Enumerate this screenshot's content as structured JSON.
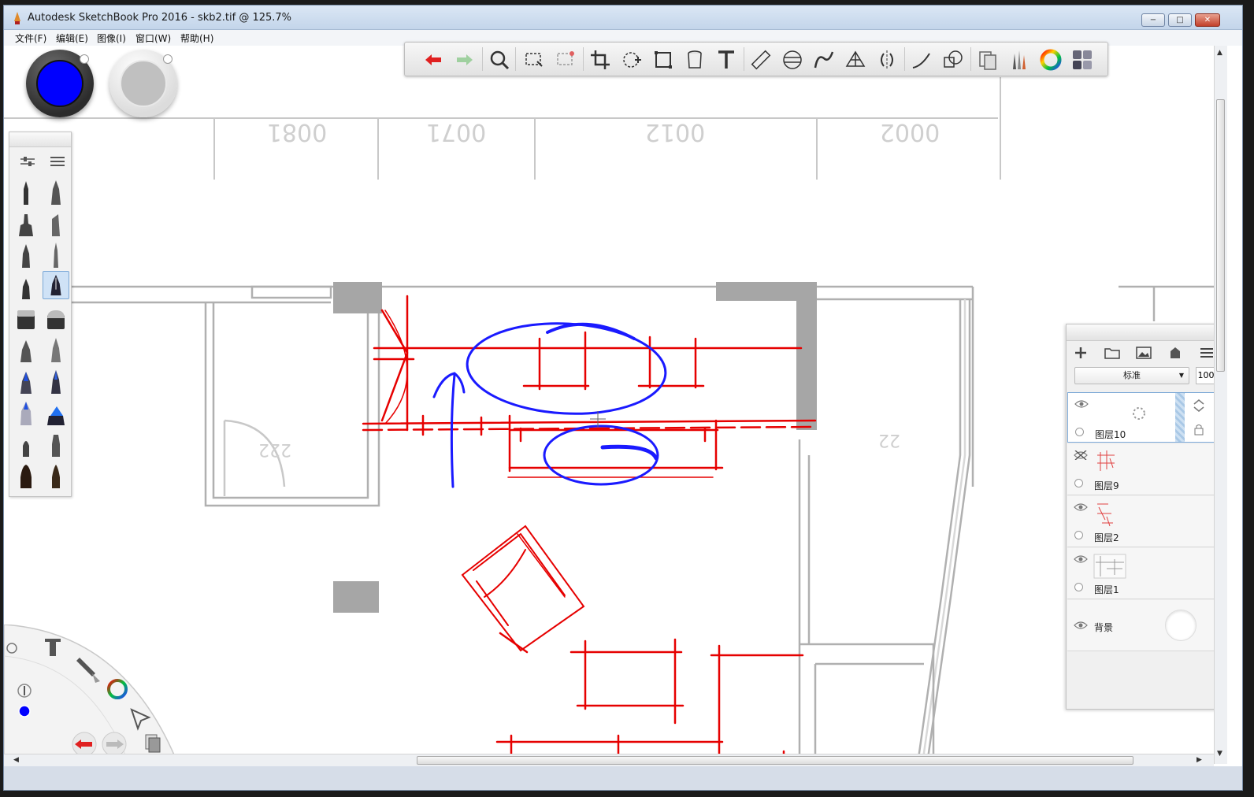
{
  "window": {
    "title": "Autodesk SketchBook Pro 2016 - skb2.tif @ 125.7%",
    "controls": {
      "minimize": "−",
      "maximize": "□",
      "close": "✕"
    }
  },
  "menu": [
    {
      "label": "文件(F)"
    },
    {
      "label": "编辑(E)"
    },
    {
      "label": "图像(I)"
    },
    {
      "label": "窗口(W)"
    },
    {
      "label": "帮助(H)"
    }
  ],
  "toolbar": {
    "tools": [
      "undo-icon",
      "redo-icon",
      "zoom-icon",
      "rect-select-icon",
      "lasso-select-icon",
      "crop-icon",
      "move-rotate-icon",
      "distort-icon",
      "fill-bucket-icon",
      "text-icon",
      "ruler-icon",
      "ellipse-guide-icon",
      "french-curve-icon",
      "perspective-icon",
      "symmetry-icon",
      "stroke-icon",
      "shape-icon",
      "copy-paste-icon",
      "brush-library-icon",
      "color-wheel-icon",
      "color-swatches-icon"
    ]
  },
  "colors": {
    "primary": "#0000ff",
    "secondary": "#c0c0c0",
    "markup_red": "#e60000",
    "markup_blue": "#1a1aff",
    "plan_gray": "#9a9a9a"
  },
  "plan": {
    "dimensions": [
      "0081",
      "0071",
      "0012",
      "0002"
    ],
    "room_labels": [
      "222",
      "22"
    ]
  },
  "layers": {
    "blend_mode": "标准",
    "opacity": "100",
    "items": [
      {
        "name": "图层10",
        "visible": true,
        "selected": true
      },
      {
        "name": "图层9",
        "visible": false,
        "selected": false
      },
      {
        "name": "图层2",
        "visible": true,
        "selected": false
      },
      {
        "name": "图层1",
        "visible": true,
        "selected": false
      },
      {
        "name": "背景",
        "visible": true,
        "selected": false
      }
    ]
  }
}
